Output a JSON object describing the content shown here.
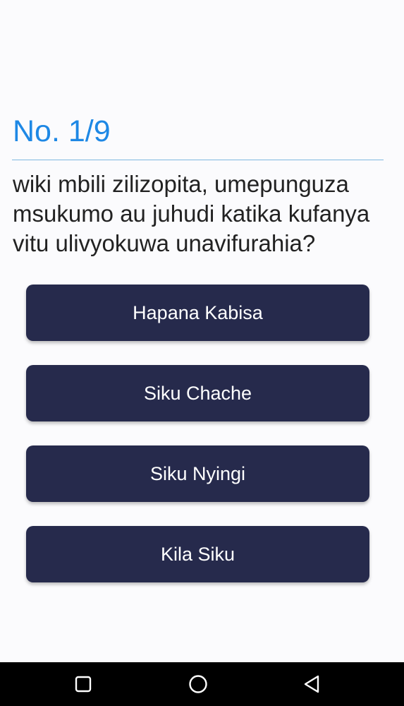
{
  "quiz": {
    "counter": "No. 1/9",
    "question": "wiki mbili zilizopita, umepunguza msukumo au juhudi katika kufanya vitu ulivyokuwa unavifurahia?",
    "answers": [
      {
        "label": "Hapana Kabisa"
      },
      {
        "label": "Siku Chache"
      },
      {
        "label": "Siku Nyingi"
      },
      {
        "label": "Kila Siku"
      }
    ]
  },
  "navbar": {
    "icons": [
      "recent-apps-icon",
      "home-icon",
      "back-icon"
    ]
  },
  "colors": {
    "accent": "#1e88e5",
    "button_bg": "#262a4c",
    "button_text": "#ffffff",
    "navbar_bg": "#000000"
  }
}
